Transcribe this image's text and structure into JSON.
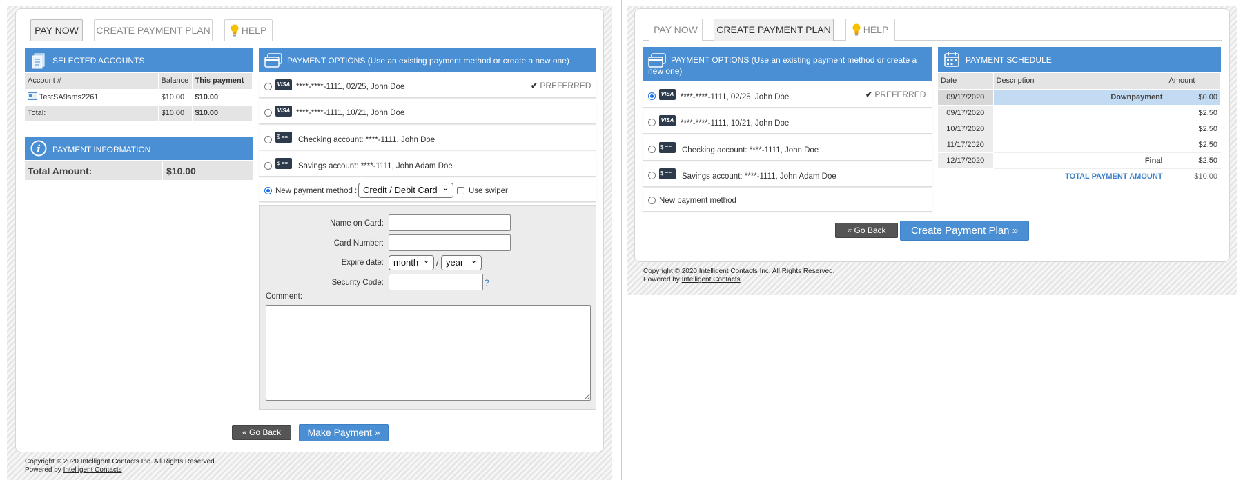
{
  "tabs": {
    "pay_now": "PAY NOW",
    "create_plan": "CREATE PAYMENT PLAN",
    "help": "HELP"
  },
  "left": {
    "selected_accounts": {
      "title": "SELECTED ACCOUNTS",
      "columns": [
        "Account #",
        "Balance",
        "This payment"
      ],
      "rows": [
        {
          "account": "TestSA9sms2261",
          "balance": "$10.00",
          "payment": "$10.00"
        }
      ],
      "total_label": "Total:",
      "total_balance": "$10.00",
      "total_payment": "$10.00"
    },
    "payment_info": {
      "title": "PAYMENT INFORMATION",
      "total_label": "Total Amount:",
      "total_value": "$10.00"
    },
    "payment_options": {
      "title": "PAYMENT OPTIONS (Use an existing payment method or create a new one)",
      "options": [
        {
          "type": "visa",
          "text": "****-****-1111, 02/25, John Doe",
          "preferred": "PREFERRED"
        },
        {
          "type": "visa",
          "text": "****-****-1111, 10/21, John Doe"
        },
        {
          "type": "bank",
          "text": "Checking account: ****-1111, John Doe"
        },
        {
          "type": "bank",
          "text": "Savings account: ****-1111, John Adam Doe"
        }
      ],
      "new_method_label": "New payment method :",
      "new_method_value": "Credit / Debit Card",
      "swiper_label": "Use swiper"
    },
    "form": {
      "name_label": "Name on Card:",
      "number_label": "Card Number:",
      "expire_label": "Expire date:",
      "month": "month",
      "year": "year",
      "slash": "/",
      "security_label": "Security Code:",
      "security_help": "?",
      "comment_label": "Comment:"
    },
    "buttons": {
      "back": "« Go Back",
      "submit": "Make Payment »"
    }
  },
  "right": {
    "payment_options": {
      "title": "PAYMENT OPTIONS (Use an existing payment method or create a new one)",
      "options": [
        {
          "type": "visa",
          "text": "****-****-1111, 02/25, John Doe",
          "preferred": "PREFERRED"
        },
        {
          "type": "visa",
          "text": "****-****-1111, 10/21, John Doe"
        },
        {
          "type": "bank",
          "text": "Checking account: ****-1111, John Doe"
        },
        {
          "type": "bank",
          "text": "Savings account: ****-1111, John Adam Doe"
        }
      ],
      "new_method_label": "New payment method"
    },
    "schedule": {
      "title": "PAYMENT SCHEDULE",
      "columns": [
        "Date",
        "Description",
        "Amount"
      ],
      "rows": [
        {
          "date": "09/17/2020",
          "desc": "Downpayment",
          "amount": "$0.00"
        },
        {
          "date": "09/17/2020",
          "desc": "",
          "amount": "$2.50"
        },
        {
          "date": "10/17/2020",
          "desc": "",
          "amount": "$2.50"
        },
        {
          "date": "11/17/2020",
          "desc": "",
          "amount": "$2.50"
        },
        {
          "date": "12/17/2020",
          "desc": "Final",
          "amount": "$2.50"
        }
      ],
      "total_label": "TOTAL PAYMENT AMOUNT",
      "total_value": "$10.00"
    },
    "buttons": {
      "back": "« Go Back",
      "submit": "Create Payment Plan »"
    }
  },
  "footer": {
    "copyright": "Copyright © 2020 Intelligent Contacts Inc. All Rights Reserved.",
    "powered_by": "Powered by",
    "link": "Intelligent Contacts"
  },
  "colors": {
    "accent": "#4a8fd4",
    "highlight_row": "#c3daf3",
    "total_blue": "#3b80c8"
  }
}
